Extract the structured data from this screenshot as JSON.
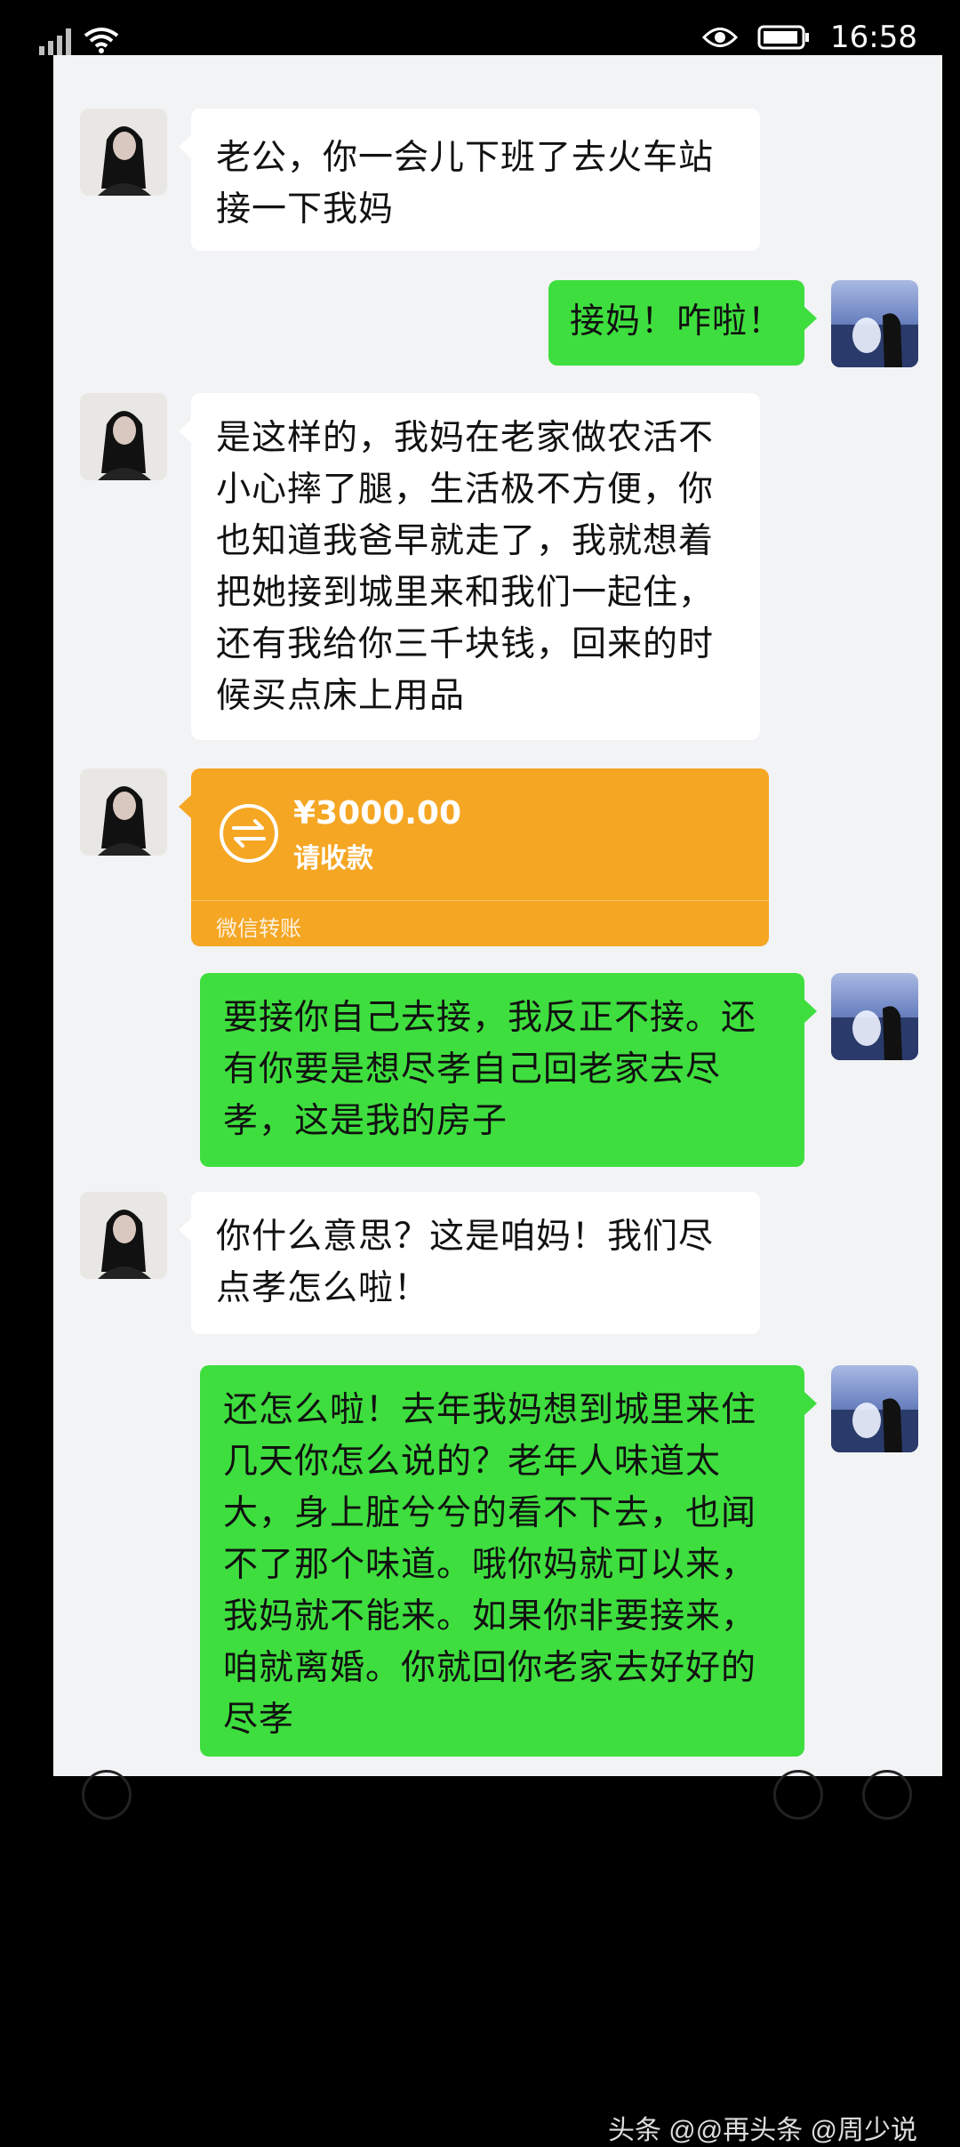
{
  "status_bar": {
    "time": "16:58",
    "icons": [
      "signal-icon",
      "wifi-icon",
      "eye-icon",
      "battery-icon"
    ]
  },
  "colors": {
    "sent_bubble": "#3ede3e",
    "received_bubble": "#ffffff",
    "transfer_card": "#f5a623",
    "chat_background": "#f2f3f5"
  },
  "messages": [
    {
      "from": "her",
      "text": "老公，你一会儿下班了去火车站接一下我妈"
    },
    {
      "from": "me",
      "text": "接妈！咋啦！"
    },
    {
      "from": "her",
      "text": "是这样的，我妈在老家做农活不小心摔了腿，生活极不方便，你也知道我爸早就走了，我就想着把她接到城里来和我们一起住，还有我给你三千块钱，回来的时候买点床上用品"
    },
    {
      "from": "me",
      "text": "要接你自己去接，我反正不接。还有你要是想尽孝自己回老家去尽孝，这是我的房子"
    },
    {
      "from": "her",
      "text": "你什么意思？这是咱妈！我们尽点孝怎么啦！"
    },
    {
      "from": "me",
      "text": "还怎么啦！去年我妈想到城里来住几天你怎么说的？老年人味道太大，身上脏兮兮的看不下去，也闻不了那个味道。哦你妈就可以来，我妈就不能来。如果你非要接来，咱就离婚。你就回你老家去好好的尽孝"
    }
  ],
  "transfer": {
    "amount": "¥3000.00",
    "status": "请收款",
    "label": "微信转账",
    "icon": "transfer-arrows-icon"
  },
  "watermark": {
    "part1": "头条 @@再头条 @周少说"
  }
}
